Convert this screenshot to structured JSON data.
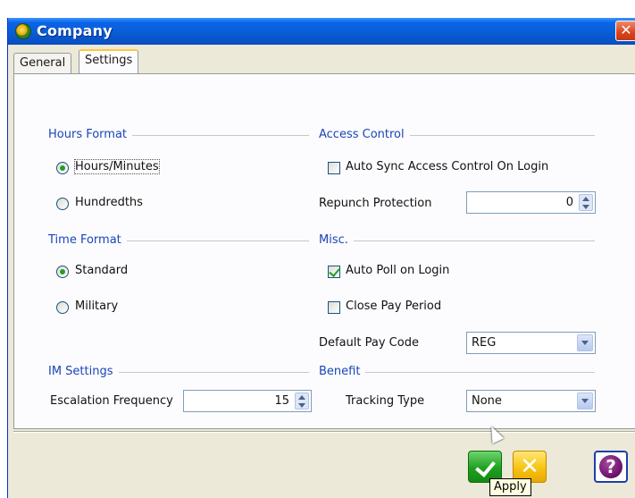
{
  "window": {
    "title": "Company",
    "close_glyph": "✕"
  },
  "tabs": [
    {
      "label": "General"
    },
    {
      "label": "Settings"
    }
  ],
  "hours_format": {
    "title": "Hours Format",
    "options": [
      {
        "label": "Hours/Minutes",
        "selected": true
      },
      {
        "label": "Hundredths",
        "selected": false
      }
    ]
  },
  "access_control": {
    "title": "Access Control",
    "auto_sync": {
      "label": "Auto Sync Access Control On Login",
      "checked": false
    },
    "repunch": {
      "label": "Repunch Protection",
      "value": "0"
    }
  },
  "time_format": {
    "title": "Time Format",
    "options": [
      {
        "label": "Standard",
        "selected": true
      },
      {
        "label": "Military",
        "selected": false
      }
    ]
  },
  "misc": {
    "title": "Misc.",
    "auto_poll": {
      "label": "Auto Poll on Login",
      "checked": true
    },
    "close_pay_period": {
      "label": "Close Pay Period",
      "checked": false
    },
    "default_pay_code": {
      "label": "Default Pay Code",
      "value": "REG"
    }
  },
  "im_settings": {
    "title": "IM Settings",
    "escalation": {
      "label": "Escalation Frequency",
      "value": "15"
    }
  },
  "benefit": {
    "title": "Benefit",
    "tracking_type": {
      "label": "Tracking Type",
      "value": "None"
    }
  },
  "buttons": {
    "help_glyph": "?",
    "cancel_glyph": "✕"
  },
  "tooltip": {
    "text": "Apply"
  },
  "colors": {
    "section_title": "#1a45b8",
    "titlebar": "#0a5fd8",
    "ok": "#20a020",
    "cancel": "#f6c412",
    "help": "#6a0f6a"
  }
}
